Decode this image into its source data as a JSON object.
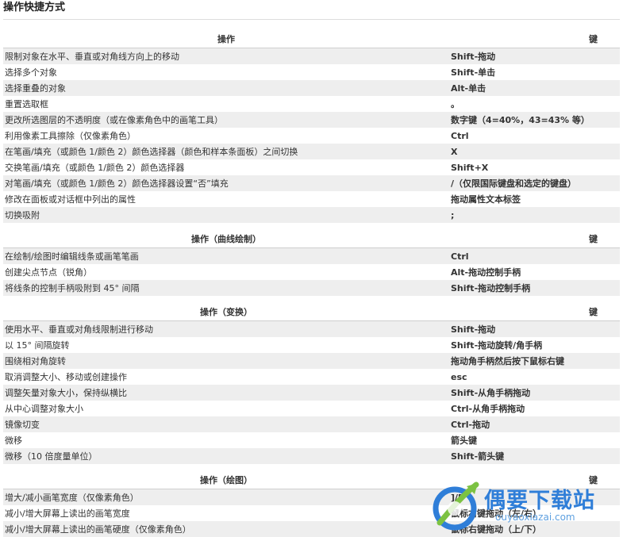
{
  "page": {
    "title": "操作快捷方式"
  },
  "sections": [
    {
      "header": [
        "操作",
        "键"
      ],
      "rows": [
        [
          "限制对象在水平、垂直或对角线方向上的移动",
          "Shift-拖动"
        ],
        [
          "选择多个对象",
          "Shift-单击"
        ],
        [
          "选择重叠的对象",
          "Alt-单击"
        ],
        [
          "重置选取框",
          "。"
        ],
        [
          "更改所选图层的不透明度（或在像素角色中的画笔工具）",
          "数字键（4=40%，43=43% 等）"
        ],
        [
          "利用像素工具擦除（仅像素角色）",
          "Ctrl"
        ],
        [
          "在笔画/填充（或颜色 1/颜色 2）颜色选择器（颜色和样本条面板）之间切换",
          "X"
        ],
        [
          "交换笔画/填充（或颜色 1/颜色 2）颜色选择器",
          "Shift+X"
        ],
        [
          "对笔画/填充（或颜色 1/颜色 2）颜色选择器设置“否”填充",
          "/（仅限国际键盘和选定的键盘）"
        ],
        [
          "修改在面板或对话框中列出的属性",
          "拖动属性文本标签"
        ],
        [
          "切换吸附",
          ";"
        ]
      ]
    },
    {
      "header": [
        "操作（曲线绘制）",
        "键"
      ],
      "rows": [
        [
          "在绘制/绘图时编辑线条或画笔笔画",
          "Ctrl"
        ],
        [
          "创建尖点节点（锐角）",
          "Alt-拖动控制手柄"
        ],
        [
          "将线条的控制手柄吸附到 45° 间隔",
          "Shift-拖动控制手柄"
        ]
      ]
    },
    {
      "header": [
        "操作（变换）",
        "键"
      ],
      "rows": [
        [
          "使用水平、垂直或对角线限制进行移动",
          "Shift-拖动"
        ],
        [
          "以 15° 间隔旋转",
          "Shift-拖动旋转/角手柄"
        ],
        [
          "围绕相对角旋转",
          "拖动角手柄然后按下鼠标右键"
        ],
        [
          "取消调整大小、移动或创建操作",
          "esc"
        ],
        [
          "调整矢量对象大小，保持纵横比",
          "Shift-从角手柄拖动"
        ],
        [
          "从中心调整对象大小",
          "Ctrl-从角手柄拖动"
        ],
        [
          "镜像切变",
          "Ctrl-拖动"
        ],
        [
          "微移",
          "箭头键"
        ],
        [
          "微移（10 倍度量单位）",
          "Shift-箭头键"
        ]
      ]
    },
    {
      "header": [
        "操作（绘图）",
        "键"
      ],
      "rows": [
        [
          "增大/减小画笔宽度（仅像素角色）",
          "]/["
        ],
        [
          "减小/增大屏幕上读出的画笔宽度",
          "鼠标右键拖动（左/右）"
        ],
        [
          "减小/增大屏幕上读出的画笔硬度（仅像素角色）",
          "鼠标右键拖动（上/下）"
        ]
      ]
    }
  ],
  "watermark": {
    "name": "偶要下载站",
    "url": "ouyaoxiazai.com",
    "colors": {
      "brand_blue": "#2f7ed8",
      "brand_light_blue": "#5ea0e0",
      "brand_green": "#7cc242"
    }
  }
}
